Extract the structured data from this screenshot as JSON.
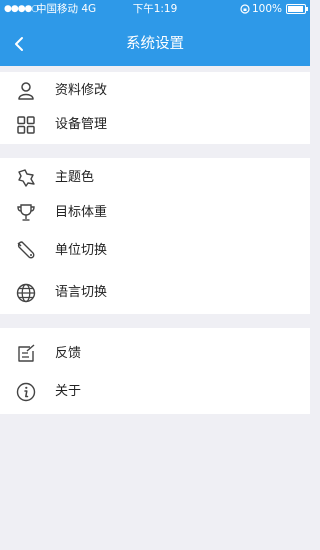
{
  "statusbar": {
    "signal": "●●●●○",
    "carrier": "中国移动  4G",
    "time": "下午1:19",
    "battery": "100%"
  },
  "navbar": {
    "title": "系统设置"
  },
  "groups": [
    {
      "items": [
        {
          "label": "资料修改",
          "icon": "person-icon"
        },
        {
          "label": "设备管理",
          "icon": "grid-icon"
        }
      ]
    },
    {
      "items": [
        {
          "label": "主题色",
          "icon": "paint-icon"
        },
        {
          "label": "目标体重",
          "icon": "trophy-icon"
        },
        {
          "label": "单位切换",
          "icon": "wrench-icon"
        },
        {
          "label": "语言切换",
          "icon": "globe-icon"
        }
      ]
    },
    {
      "items": [
        {
          "label": "反馈",
          "icon": "edit-icon"
        },
        {
          "label": "关于",
          "icon": "info-icon"
        }
      ]
    }
  ],
  "colors": {
    "header": "#2e99e8",
    "background": "#efeff4",
    "icon": "#444444"
  }
}
